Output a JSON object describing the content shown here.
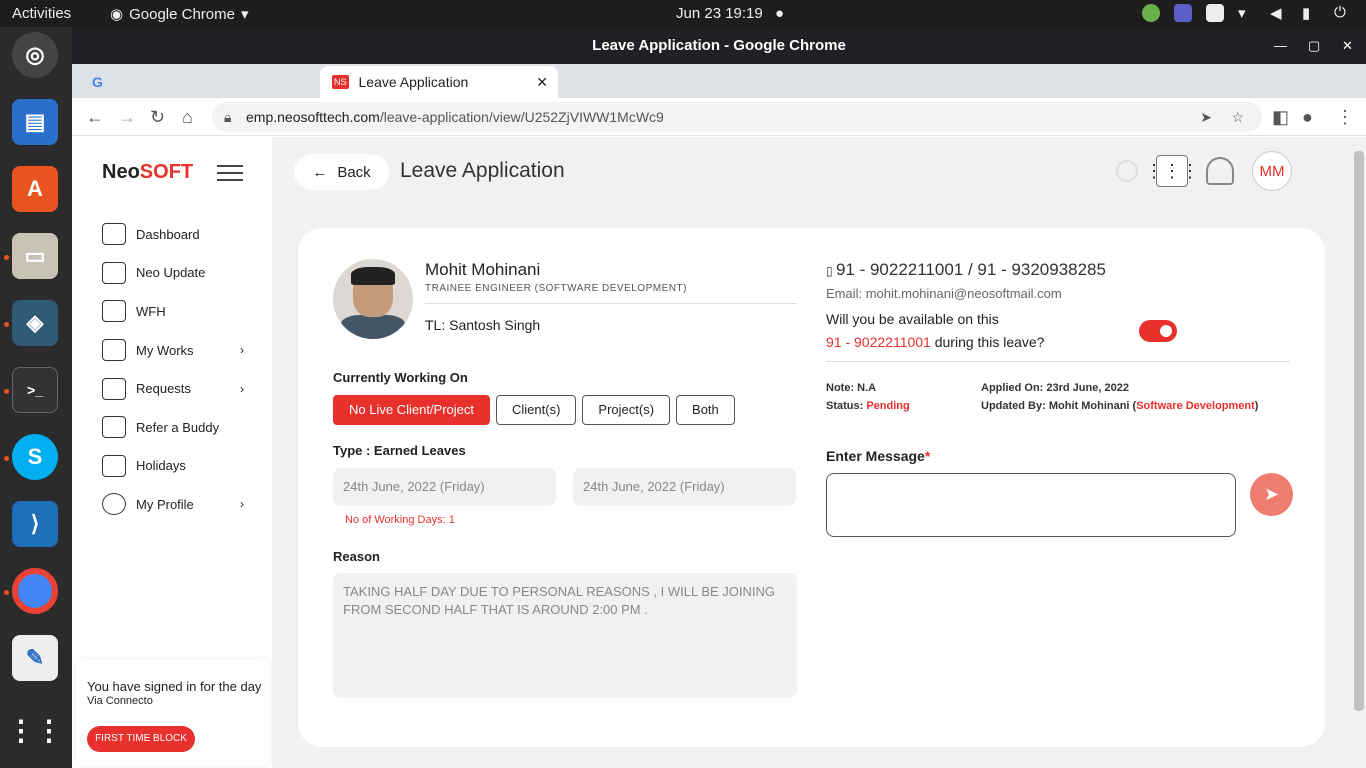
{
  "system": {
    "activities": "Activities",
    "app": "Google Chrome",
    "clock": "Jun 23  19:19"
  },
  "window": {
    "title": "Leave Application - Google Chrome"
  },
  "tab": {
    "title": "Leave Application",
    "favicon": "NS"
  },
  "url": {
    "host": "emp.neosofttech.com",
    "path": "/leave-application/view/U252ZjVIWW1McWc9"
  },
  "logo": {
    "main": "Neo",
    "accent": "SOFT"
  },
  "menu": [
    {
      "label": "Dashboard",
      "has_sub": false
    },
    {
      "label": "Neo Update",
      "has_sub": false
    },
    {
      "label": "WFH",
      "has_sub": false
    },
    {
      "label": "My Works",
      "has_sub": true
    },
    {
      "label": "Requests",
      "has_sub": true
    },
    {
      "label": "Refer a Buddy",
      "has_sub": false
    },
    {
      "label": "Holidays",
      "has_sub": false
    },
    {
      "label": "My Profile",
      "has_sub": true
    }
  ],
  "signin": {
    "text": "You have signed in for the day",
    "via": "Via Connecto",
    "button": "FIRST TIME BLOCK"
  },
  "header": {
    "back": "Back",
    "title": "Leave Application",
    "avatar": "MM"
  },
  "employee": {
    "name": "Mohit Mohinani",
    "designation": "TRAINEE ENGINEER (SOFTWARE DEVELOPMENT)",
    "tl": "TL: Santosh Singh",
    "phones": "91 - 9022211001 /  91 - 9320938285",
    "email": "Email: mohit.mohinani@neosoftmail.com"
  },
  "working": {
    "label": "Currently Working On",
    "options": [
      "No Live Client/Project",
      "Client(s)",
      "Project(s)",
      "Both"
    ],
    "selected": "No Live Client/Project"
  },
  "leave": {
    "type": "Type : Earned Leaves",
    "from": "24th June, 2022 (Friday)",
    "to": "24th June, 2022 (Friday)",
    "working_days": "No of Working Days:  1",
    "reason_label": "Reason",
    "reason": "TAKING HALF DAY  DUE TO PERSONAL REASONS  , I WILL BE JOINING FROM SECOND HALF THAT IS AROUND 2:00 PM ."
  },
  "availability": {
    "q1": "Will you be available on this",
    "phone": "91 - 9022211001",
    "q2": " during this leave?",
    "enabled": true
  },
  "meta": {
    "note": "Note: N.A",
    "status_label": "Status: ",
    "status": "Pending",
    "applied": "Applied On: 23rd June, 2022",
    "updated_label": "Updated By: Mohit Mohinani (",
    "updated_dept": "Software Development",
    "updated_close": ")"
  },
  "message": {
    "label": "Enter Message",
    "required": "*"
  }
}
